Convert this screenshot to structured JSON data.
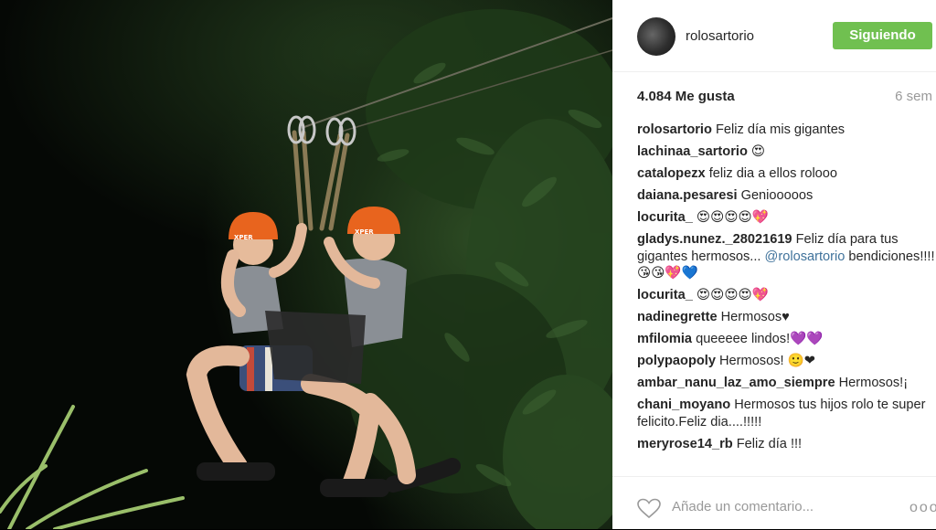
{
  "post": {
    "username": "rolosartorio",
    "follow_label": "Siguiendo",
    "likes": "4.084 Me gusta",
    "time": "6 sem",
    "add_comment_placeholder": "Añade un comentario...",
    "more_label": "ooo"
  },
  "comments": [
    {
      "user": "rolosartorio",
      "text": "Feliz día mis gigantes"
    },
    {
      "user": "lachinaa_sartorio",
      "text": "😍"
    },
    {
      "user": "catalopezx",
      "text": "feliz dia a ellos rolooo"
    },
    {
      "user": "daiana.pesaresi",
      "text": "Geniooooos"
    },
    {
      "user": "locurita_",
      "text": "😍😍😍😍💖"
    },
    {
      "user": "gladys.nunez._28021619",
      "text": "Feliz día para tus gigantes hermosos...",
      "mention": "@rolosartorio",
      "text2": "bendiciones!!!!😘😘💖💙"
    },
    {
      "user": "locurita_",
      "text": "😍😍😍😍💖"
    },
    {
      "user": "nadinegrette",
      "text": "Hermosos♥"
    },
    {
      "user": "mfilomia",
      "text": "queeeee lindos!💜💜"
    },
    {
      "user": "polypaopoly",
      "text": "Hermosos! 🙂❤"
    },
    {
      "user": "ambar_nanu_laz_amo_siempre",
      "text": "Hermosos!¡"
    },
    {
      "user": "chani_moyano",
      "text": "Hermosos tus hijos rolo te super felicito.Feliz dia....!!!!!"
    },
    {
      "user": "meryrose14_rb",
      "text": "Feliz día !!!"
    }
  ],
  "photo": {
    "helmet_text": "XPER"
  },
  "colors": {
    "follow": "#70c050",
    "mention": "#3f729b",
    "helmet": "#e8641e"
  }
}
